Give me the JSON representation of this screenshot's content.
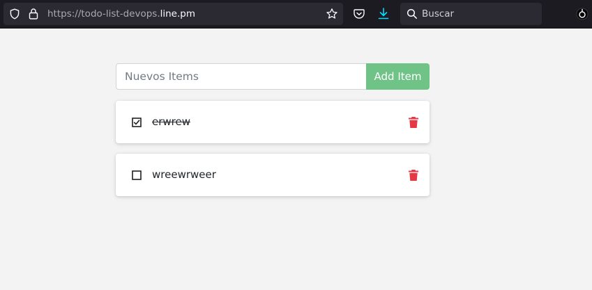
{
  "browser": {
    "url_prefix": "https://todo-list-devops.",
    "url_host": "line.pm",
    "search_placeholder": "Buscar",
    "accent_download_color": "#00ddff"
  },
  "app": {
    "input_placeholder": "Nuevos Items",
    "add_button_label": "Add Item",
    "add_button_color": "#70c387",
    "delete_icon_color": "#e63946",
    "items": [
      {
        "text": "erwrew",
        "completed": true
      },
      {
        "text": "wreewrweer",
        "completed": false
      }
    ]
  }
}
